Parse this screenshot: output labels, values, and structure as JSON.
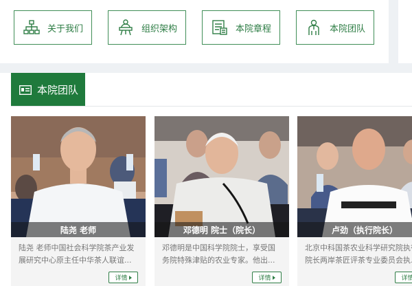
{
  "nav": [
    {
      "label": "关于我们",
      "icon": "org-network-icon"
    },
    {
      "label": "组织架构",
      "icon": "presenter-podium-icon"
    },
    {
      "label": "本院章程",
      "icon": "document-charter-icon"
    },
    {
      "label": "本院团队",
      "icon": "team-member-icon"
    }
  ],
  "section": {
    "title": "本院团队",
    "icon": "id-card-icon"
  },
  "team": [
    {
      "caption": "陆尧 老师",
      "desc": "陆尧 老师中国社会科学院茶产业发展研究中心原主任中华茶人联谊...",
      "detail": "详情"
    },
    {
      "caption": "邓德明 院士（院长）",
      "desc": "邓德明是中国科学院院士，享受国务院特殊津贴的农业专家。他出...",
      "detail": "详情"
    },
    {
      "caption": "卢劲（执行院长）",
      "desc": "北京中科国茶农业科学研究院执行院长两岸茶匠评茶专业委员会执...",
      "detail": "详情"
    }
  ],
  "colors": {
    "brand_green": "#1f7a3c",
    "button_border": "#3f8d56"
  }
}
